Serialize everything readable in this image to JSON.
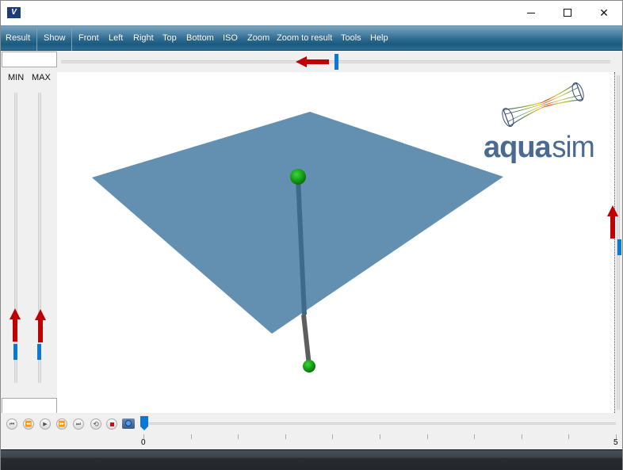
{
  "window": {
    "app_icon": "aquasim-app-icon",
    "controls": {
      "minimize_icon": "minimize-icon",
      "maximize_icon": "maximize-icon",
      "close_glyph": "✕"
    }
  },
  "menubar": {
    "items": [
      {
        "label": "Result"
      },
      {
        "label": "Show"
      },
      {
        "label": "Front"
      },
      {
        "label": "Left"
      },
      {
        "label": "Right"
      },
      {
        "label": "Top"
      },
      {
        "label": "Bottom"
      },
      {
        "label": "ISO"
      },
      {
        "label": "Zoom"
      },
      {
        "label": "Zoom to result"
      },
      {
        "label": "Tools"
      },
      {
        "label": "Help"
      }
    ]
  },
  "top_slider": {
    "input_value": "",
    "position_fraction": 0.5,
    "annotation_arrow": "left",
    "annotation_color": "#c00000"
  },
  "left_panel": {
    "min_label": "MIN",
    "max_label": "MAX",
    "min_slider_fraction": 0.08,
    "max_slider_fraction": 0.08,
    "bottom_input_value": "",
    "annotation_color": "#c00000"
  },
  "right_slider": {
    "position_fraction": 0.5,
    "annotation_color": "#c00000"
  },
  "viewport": {
    "plane_color": "#6390b0",
    "line_color": "#5a5a5a",
    "sphere_color": "#1aa31a",
    "logo": {
      "text_bold": "aqua",
      "text_light": "sim",
      "color": "#4a6a92"
    }
  },
  "timeline": {
    "controls": [
      {
        "name": "skip-to-start-icon",
        "glyph": "⏮"
      },
      {
        "name": "rewind-icon",
        "glyph": "⏪"
      },
      {
        "name": "play-icon",
        "glyph": "▶"
      },
      {
        "name": "fast-forward-icon",
        "glyph": "⏩"
      },
      {
        "name": "skip-to-end-icon",
        "glyph": "⏭"
      },
      {
        "name": "loop-icon",
        "glyph": "⟲"
      },
      {
        "name": "record-stop-icon",
        "glyph": ""
      }
    ],
    "camera_icon": "camera-icon",
    "start_label": "0",
    "end_label": "5",
    "current_value": 0,
    "accent_color": "#0a78d7"
  }
}
